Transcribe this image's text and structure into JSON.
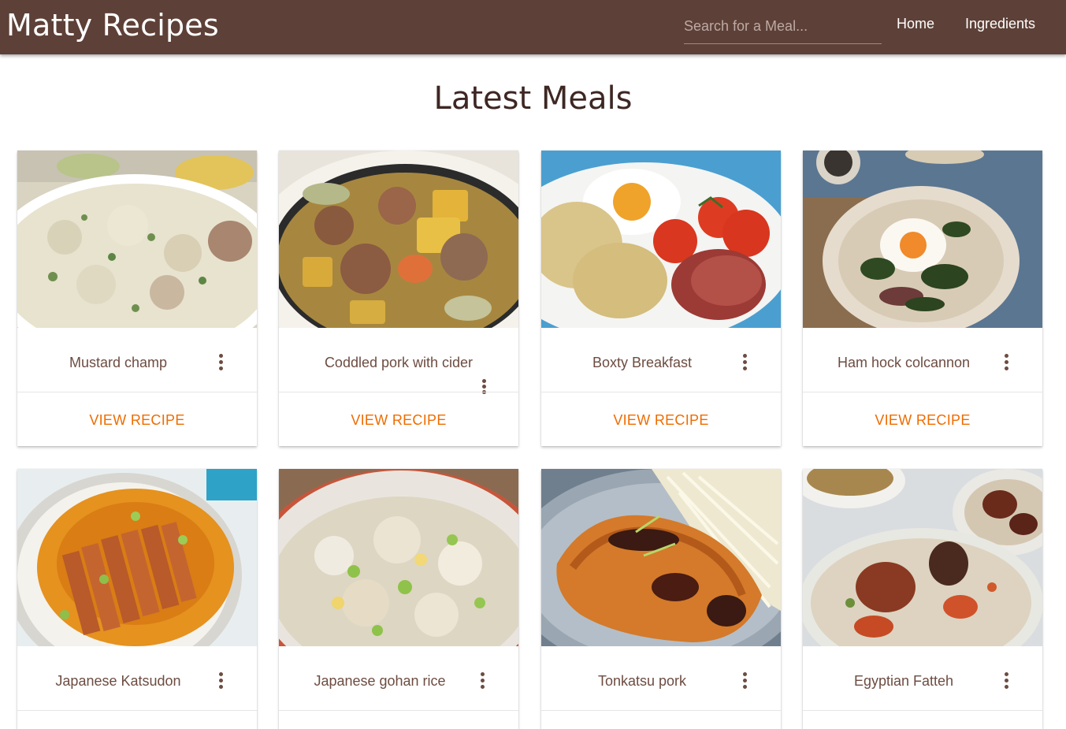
{
  "app": {
    "brand": "Matty Recipes",
    "search_placeholder": "Search for a Meal...",
    "nav": [
      "Home",
      "Ingredients"
    ]
  },
  "page": {
    "heading": "Latest Meals"
  },
  "colors": {
    "navbar": "#5d4037",
    "accent": "#ef6c00",
    "card_text": "#6d4c41"
  },
  "meals": [
    {
      "title": "Mustard champ",
      "action": "VIEW RECIPE",
      "image": "mashed-potato-photo"
    },
    {
      "title": "Coddled pork with cider",
      "action": "VIEW RECIPE",
      "image": "pork-stew-photo"
    },
    {
      "title": "Boxty Breakfast",
      "action": "VIEW RECIPE",
      "image": "boxty-breakfast-photo"
    },
    {
      "title": "Ham hock colcannon",
      "action": "VIEW RECIPE",
      "image": "colcannon-egg-photo"
    },
    {
      "title": "Japanese Katsudon",
      "image": "katsudon-photo"
    },
    {
      "title": "Japanese gohan rice",
      "image": "fried-rice-photo"
    },
    {
      "title": "Tonkatsu pork",
      "image": "tonkatsu-photo"
    },
    {
      "title": "Egyptian Fatteh",
      "image": "fatteh-photo"
    }
  ]
}
